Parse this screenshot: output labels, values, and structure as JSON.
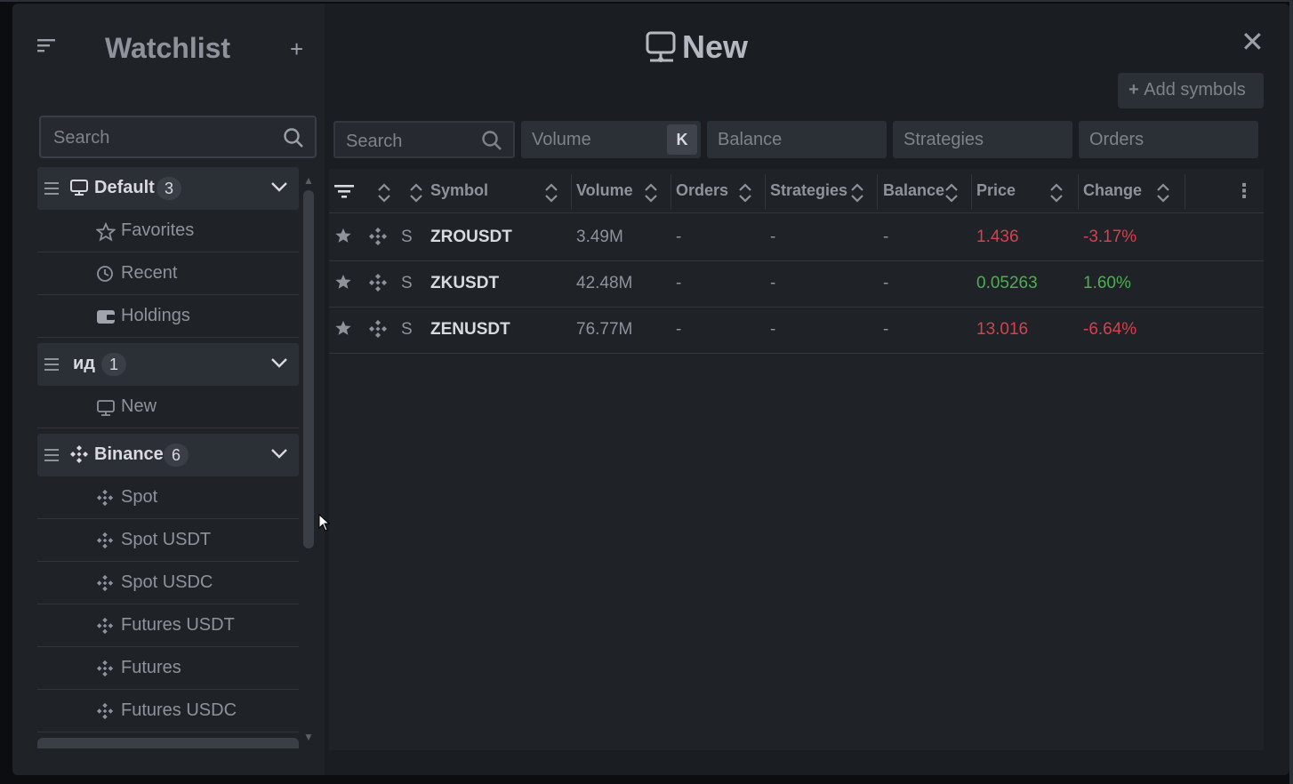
{
  "sidebar": {
    "title": "Watchlist",
    "search_placeholder": "Search",
    "groups": [
      {
        "name": "Default",
        "count": "3",
        "items": [
          "Favorites",
          "Recent",
          "Holdings"
        ]
      },
      {
        "name": "ид",
        "count": "1",
        "items": [
          "New"
        ]
      },
      {
        "name": "Binance",
        "count": "6",
        "items": [
          "Spot",
          "Spot USDT",
          "Spot USDC",
          "Futures USDT",
          "Futures",
          "Futures USDC"
        ]
      }
    ]
  },
  "main": {
    "title": "New",
    "add_symbols_label": "Add symbols",
    "filters": {
      "search": "Search",
      "volume": "Volume",
      "volume_unit": "K",
      "balance": "Balance",
      "strategies": "Strategies",
      "orders": "Orders"
    },
    "columns": [
      "Symbol",
      "Volume",
      "Orders",
      "Strategies",
      "Balance",
      "Price",
      "Change"
    ],
    "rows": [
      {
        "market": "S",
        "symbol": "ZROUSDT",
        "volume": "3.49M",
        "orders": "-",
        "strategies": "-",
        "balance": "-",
        "price": "1.436",
        "change": "-3.17%",
        "trend": "down"
      },
      {
        "market": "S",
        "symbol": "ZKUSDT",
        "volume": "42.48M",
        "orders": "-",
        "strategies": "-",
        "balance": "-",
        "price": "0.05263",
        "change": "1.60%",
        "trend": "up"
      },
      {
        "market": "S",
        "symbol": "ZENUSDT",
        "volume": "76.77M",
        "orders": "-",
        "strategies": "-",
        "balance": "-",
        "price": "13.016",
        "change": "-6.64%",
        "trend": "down"
      }
    ]
  },
  "colors": {
    "negative": "#d2424f",
    "positive": "#4fae53",
    "background": "#1f2227"
  }
}
